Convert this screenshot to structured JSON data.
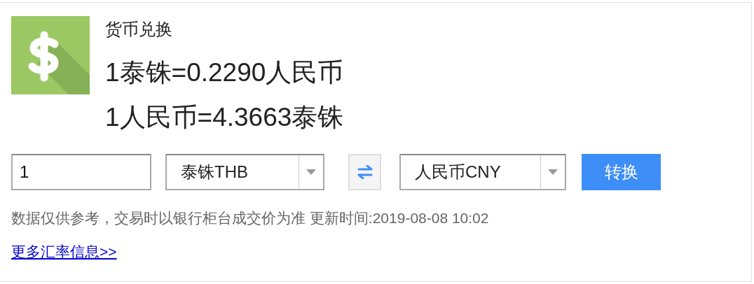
{
  "widget": {
    "title": "货币兑换",
    "rates": [
      "1泰铢=0.2290人民币",
      "1人民币=4.3663泰铢"
    ]
  },
  "converter": {
    "amount": "1",
    "from_currency": "泰铢THB",
    "to_currency": "人民币CNY",
    "convert_button": "转换"
  },
  "note": "数据仅供参考，交易时以银行柜台成交价为准 更新时间:2019-08-08 10:02",
  "more_link": "更多汇率信息>>"
}
